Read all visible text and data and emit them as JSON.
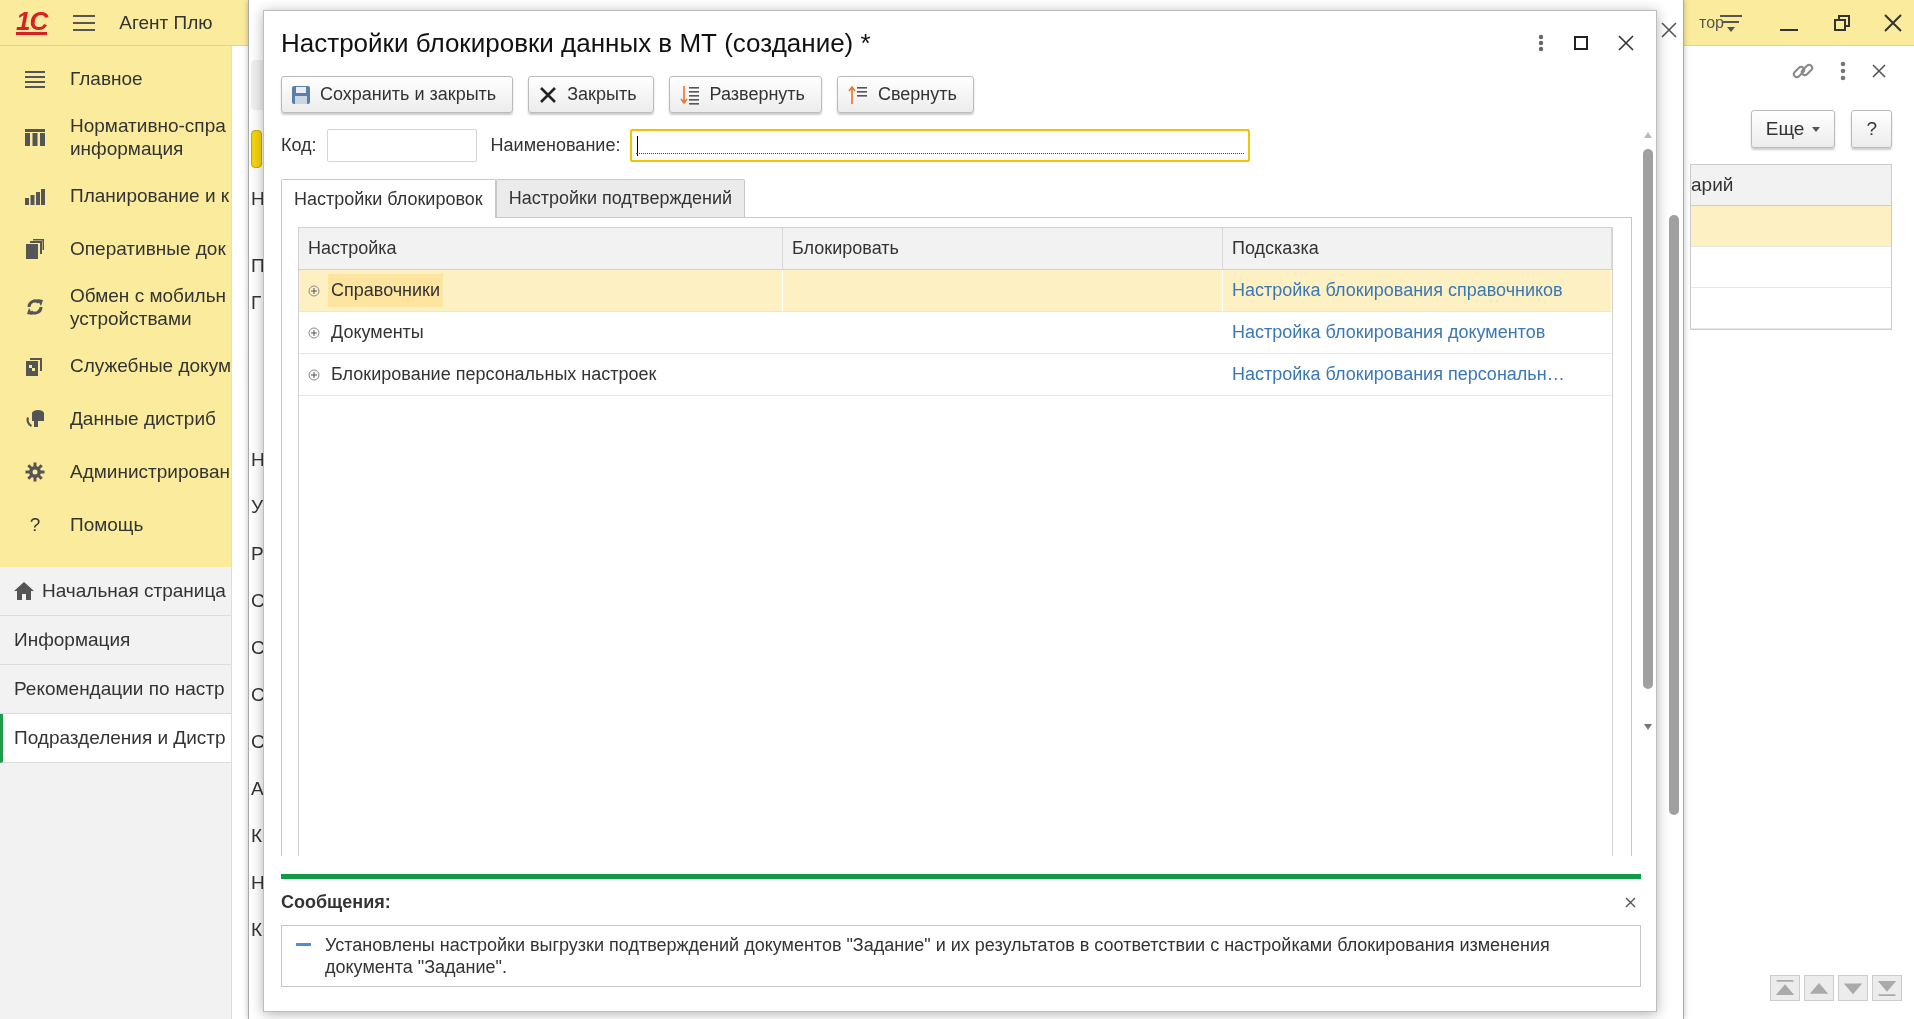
{
  "app_bar": {
    "logo": "1С",
    "title": "Агент Плю",
    "user": "тор"
  },
  "sidebar": {
    "sections": [
      {
        "label": "Главное"
      },
      {
        "label": "Нормативно-спра\nинформация"
      },
      {
        "label": "Планирование и к"
      },
      {
        "label": "Оперативные док"
      },
      {
        "label": "Обмен с мобильн\nустройствами"
      },
      {
        "label": "Служебные докум"
      },
      {
        "label": "Данные дистриб"
      },
      {
        "label": "Администрирован"
      },
      {
        "label": "Помощь",
        "glyph": "?"
      }
    ],
    "open_pages": [
      {
        "label": "Начальная страница",
        "selected": false
      },
      {
        "label": "Информация",
        "selected": false
      },
      {
        "label": "Рекомендации по настр",
        "selected": false
      },
      {
        "label": "Подразделения и Дистр",
        "selected": true
      }
    ]
  },
  "background_form": {
    "labels": [
      "Н",
      "П",
      "Г",
      "Н",
      "У",
      "Р",
      "С",
      "С",
      "С",
      "С",
      "А",
      "К",
      "Н",
      "К"
    ]
  },
  "dialog": {
    "title": "Настройки блокировки данных в МТ (создание) *",
    "buttons": [
      {
        "label": "Сохранить и закрыть"
      },
      {
        "label": "Закрыть"
      },
      {
        "label": "Развернуть"
      },
      {
        "label": "Свернуть"
      }
    ],
    "fields": [
      {
        "label": "Код:",
        "focused": false
      },
      {
        "label": "Наименование:",
        "focused": true
      }
    ],
    "tabs": [
      {
        "label": "Настройки блокировок",
        "selected": true
      },
      {
        "label": "Настройки подтверждений",
        "selected": false
      }
    ],
    "table": {
      "columns": [
        "Настройка",
        "Блокировать",
        "Подсказка"
      ],
      "rows": [
        {
          "name": "Справочники",
          "hint": "Настройка блокирования справочников",
          "selected": true,
          "expanded": false
        },
        {
          "name": "Документы",
          "hint": "Настройка блокирования документов",
          "selected": false,
          "expanded": false
        },
        {
          "name": "Блокирование персональных настроек",
          "hint": "Настройка блокирования персональн…",
          "selected": false,
          "expanded": false
        }
      ]
    },
    "messages": {
      "title": "Сообщения:",
      "items": [
        "Установлены настройки выгрузки подтверждений документов \"Задание\" и их результатов в соответствии с настройками блокирования изменения документа \"Задание\"."
      ]
    }
  },
  "right_panel": {
    "buttons": [
      "Еще",
      "?"
    ],
    "table": {
      "columns": [
        "арий"
      ],
      "rows": [
        {
          "selected": true
        },
        {
          "selected": false
        },
        {
          "selected": false
        }
      ]
    }
  }
}
